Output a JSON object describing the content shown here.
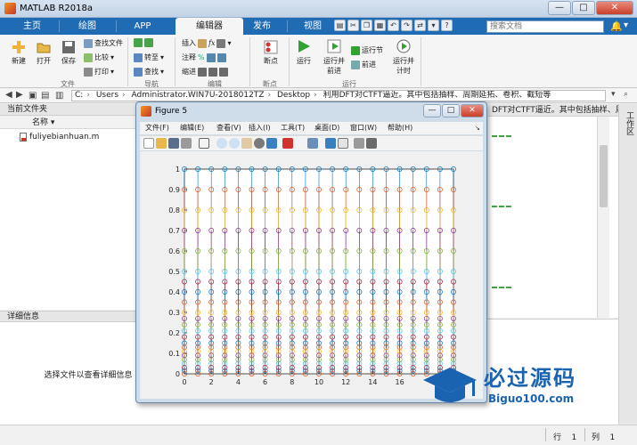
{
  "window": {
    "title": "MATLAB R2018a",
    "min": "—",
    "max": "□",
    "close": "✕"
  },
  "tabs": [
    "主页",
    "绘图",
    "APP",
    "编辑器",
    "发布",
    "视图"
  ],
  "active_tab": "编辑器",
  "search": {
    "placeholder": "搜索文档"
  },
  "ribbon": {
    "new": "新建",
    "open": "打开",
    "save": "保存",
    "find_files": "查找文件",
    "compare": "比较",
    "print": "打印",
    "go_to": "转至",
    "find": "查找",
    "insert": "插入",
    "comment": "注释",
    "indent": "缩进",
    "breakpoints": "断点",
    "run": "运行",
    "run_advance": "运行并\n前进",
    "run_section": "运行节",
    "advance": "前进",
    "run_time": "运行并\n计时",
    "sections": {
      "file": "文件",
      "nav": "导航",
      "edit": "编辑",
      "bp": "断点",
      "run": "运行"
    }
  },
  "address": {
    "crumbs": [
      "C:",
      "Users",
      "Administrator.WIN7U-2018012TZ",
      "Desktop",
      "利用DFT对CTFT逼近。其中包括抽样、周期延拓、卷积、截短等"
    ]
  },
  "current_folder": {
    "header": "当前文件夹",
    "column": "名称",
    "files": [
      "fuliyebianhuan.m"
    ]
  },
  "details": {
    "header": "详细信息",
    "empty": "选择文件以查看详细信息"
  },
  "editor": {
    "tab": "DFT对CTFT逼近。其中包括抽样、周期延拓、卷..."
  },
  "workspace": {
    "label": "工作区"
  },
  "status": {
    "line_label": "行",
    "line": "1",
    "col_label": "列",
    "col": "1"
  },
  "figure": {
    "title": "Figure 5",
    "menu": [
      "文件(F)",
      "编辑(E)",
      "查看(V)",
      "插入(I)",
      "工具(T)",
      "桌面(D)",
      "窗口(W)",
      "帮助(H)"
    ]
  },
  "watermark": {
    "text": "必过源码",
    "url": "Biguo100.com"
  },
  "chart_data": {
    "type": "scatter",
    "subtype": "stem",
    "x": [
      0,
      1,
      2,
      3,
      4,
      5,
      6,
      7,
      8,
      9,
      10,
      11,
      12,
      13,
      14,
      15,
      16,
      17,
      18,
      19,
      20
    ],
    "series_levels": [
      1,
      0.9,
      0.8,
      0.7,
      0.6,
      0.5,
      0.45,
      0.4,
      0.35,
      0.3,
      0.27,
      0.24,
      0.21,
      0.18,
      0.15,
      0.13,
      0.11,
      0.09,
      0.07,
      0.05,
      0.03,
      0.015,
      0
    ],
    "series_colors": [
      "#0072BD",
      "#D95319",
      "#EDB120",
      "#7E2F8E",
      "#77AC30",
      "#4DBEEE",
      "#A2142F"
    ],
    "xticks": [
      0,
      2,
      4,
      6,
      8,
      10,
      12,
      14,
      16
    ],
    "yticks": [
      0,
      0.1,
      0.2,
      0.3,
      0.4,
      0.5,
      0.6,
      0.7,
      0.8,
      0.9,
      1
    ],
    "xlim": [
      0,
      20
    ],
    "ylim": [
      0,
      1
    ],
    "grid": false
  }
}
